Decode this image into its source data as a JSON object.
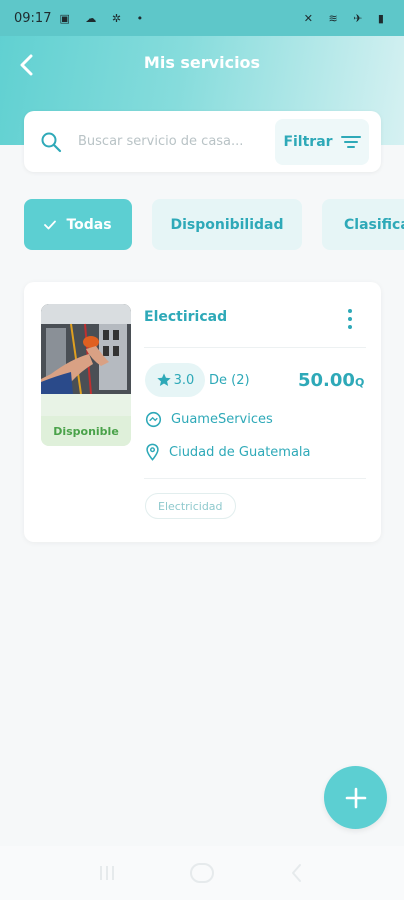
{
  "status_bar": {
    "time": "09:17"
  },
  "header": {
    "title": "Mis servicios"
  },
  "search": {
    "placeholder": "Buscar servicio de casa...",
    "filter_label": "Filtrar"
  },
  "chips": [
    {
      "label": "Todas",
      "active": true
    },
    {
      "label": "Disponibilidad",
      "active": false
    },
    {
      "label": "Clasificación",
      "active": false
    }
  ],
  "service": {
    "title": "Electiricad",
    "availability": "Disponible",
    "rating": "3.0",
    "reviews": "De (2)",
    "price": "50.00",
    "currency": "Q",
    "provider": "GuameServices",
    "location": "Ciudad de Guatemala",
    "tag": "Electricidad"
  },
  "colors": {
    "accent": "#5ccfd2",
    "text_accent": "#2ea9b8",
    "available": "#4aa24a"
  },
  "icons": [
    "back-arrow-icon",
    "search-icon",
    "filter-icon",
    "check-icon",
    "star-icon",
    "more-vert-icon",
    "provider-icon",
    "location-pin-icon",
    "plus-icon",
    "recents-icon",
    "home-icon",
    "nav-back-icon"
  ]
}
